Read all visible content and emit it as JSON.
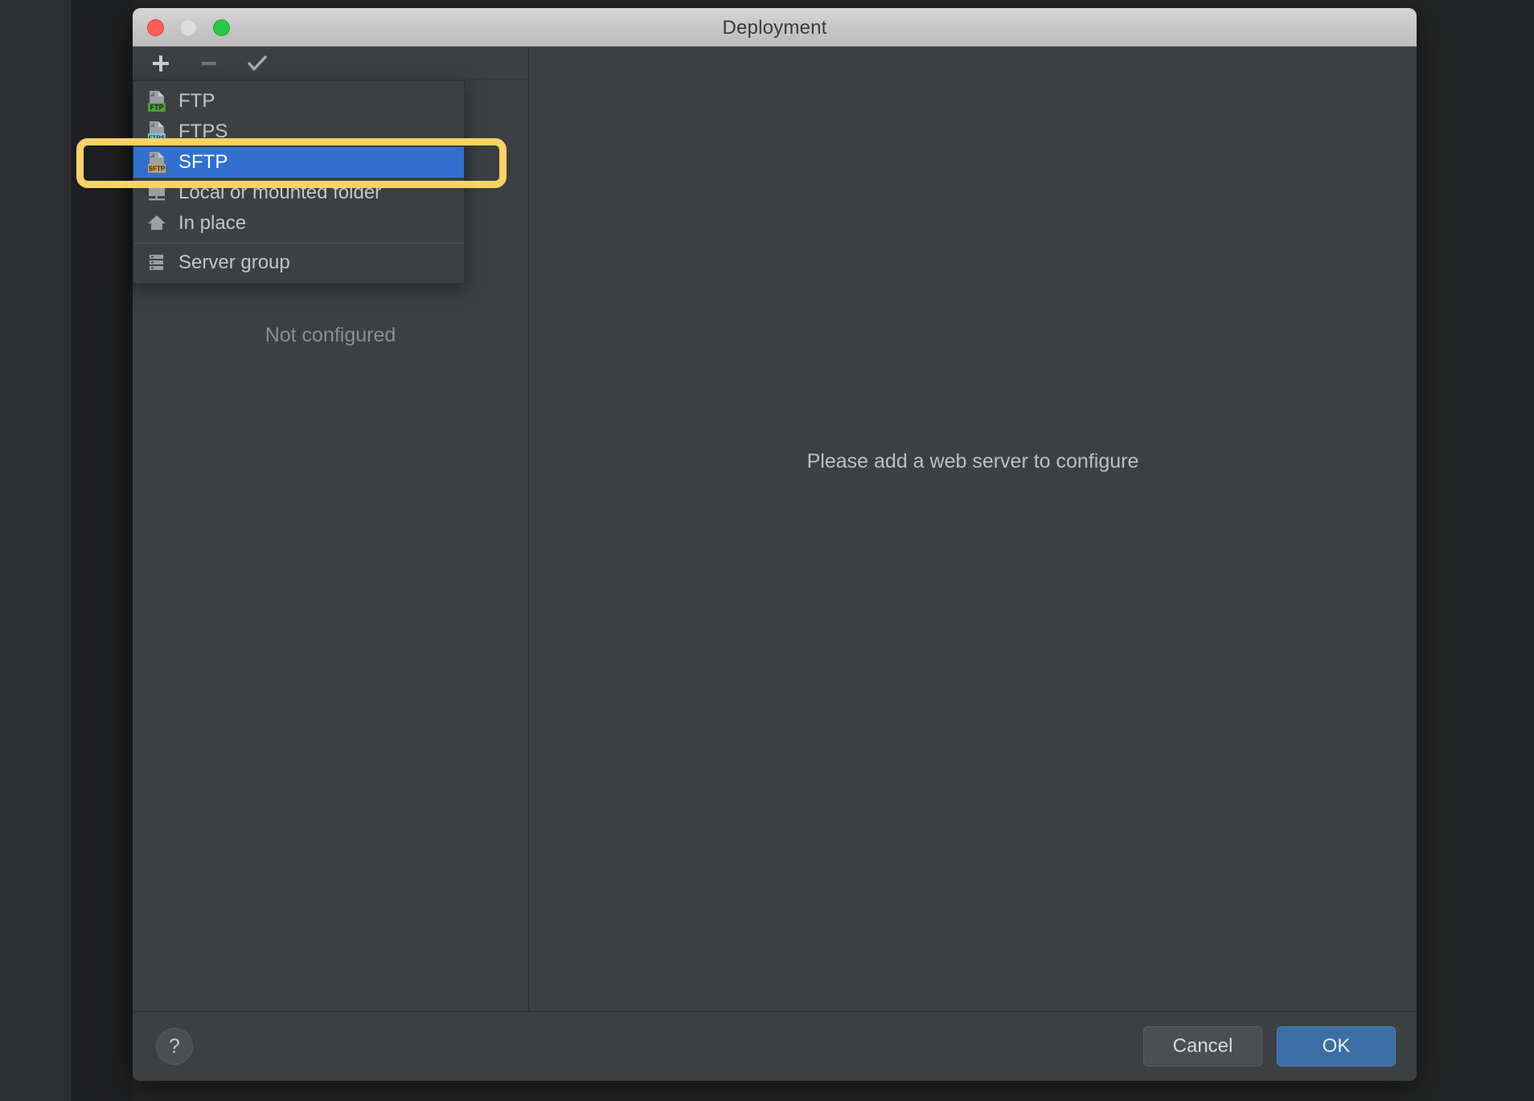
{
  "window": {
    "title": "Deployment",
    "traffic_lights": [
      "close-button",
      "minimize-button",
      "zoom-button"
    ]
  },
  "toolbar": {
    "add_label": "+",
    "remove_label": "−",
    "check_label": "✓",
    "icons": [
      "add-icon",
      "remove-icon",
      "check-icon"
    ]
  },
  "menu": {
    "items": [
      {
        "label": "FTP",
        "icon": "ftp-icon",
        "badge": "FTP",
        "badge_color": "#4e9a3e",
        "selected": false
      },
      {
        "label": "FTPS",
        "icon": "ftps-icon",
        "badge": "FTPS",
        "badge_color": "#7ec8d8",
        "selected": false
      },
      {
        "label": "SFTP",
        "icon": "sftp-icon",
        "badge": "SFTP",
        "badge_color": "#bfa26a",
        "selected": true
      },
      {
        "label": "Local or mounted folder",
        "icon": "folder-icon",
        "badge": "",
        "badge_color": "",
        "selected": false
      },
      {
        "label": "In place",
        "icon": "home-icon",
        "badge": "",
        "badge_color": "",
        "selected": false
      }
    ],
    "group_item": {
      "label": "Server group",
      "icon": "server-group-icon"
    },
    "selection_color": "#3270cf"
  },
  "left_pane": {
    "empty_text": "Not configured"
  },
  "right_pane": {
    "message": "Please add a web server to configure"
  },
  "footer": {
    "help_label": "?",
    "cancel_label": "Cancel",
    "ok_label": "OK",
    "ok_color": "#3b6ea5"
  },
  "annotation": {
    "highlight_color": "#fbd267",
    "target": "SFTP"
  }
}
